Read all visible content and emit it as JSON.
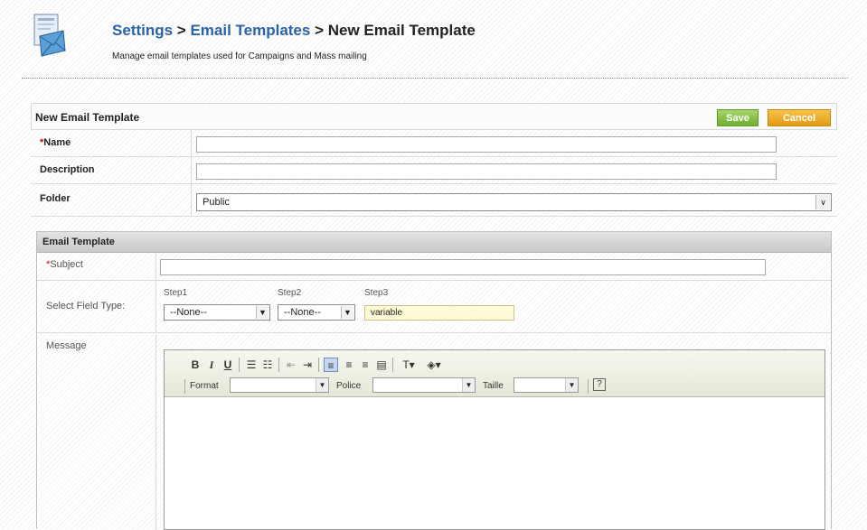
{
  "header": {
    "crumb_settings": "Settings",
    "sep1": " > ",
    "crumb_templates": "Email Templates",
    "sep2": " > ",
    "crumb_current": "New Email Template",
    "subtitle": "Manage email templates used for Campaigns and Mass mailing",
    "icon": "email-template-icon"
  },
  "form": {
    "title": "New Email Template",
    "save_label": "Save",
    "cancel_label": "Cancel",
    "name_req": "*",
    "name_label": "Name",
    "description_label": "Description",
    "folder_label": "Folder",
    "folder_value": "Public",
    "name_value": "",
    "description_value": ""
  },
  "template": {
    "title": "Email Template",
    "subject_req": "*",
    "subject_label": "Subject",
    "subject_value": "",
    "field_type_label": "Select Field Type:",
    "step1_label": "Step1",
    "step2_label": "Step2",
    "step3_label": "Step3",
    "step1_value": "--None--",
    "step2_value": "--None--",
    "step3_value": "variable",
    "message_label": "Message"
  },
  "editor": {
    "bold": "B",
    "italic": "I",
    "underline": "U",
    "format_label": "Format",
    "font_label": "Police",
    "size_label": "Taille",
    "help": "?"
  },
  "colors": {
    "link": "#2a62a8",
    "save": "#6fae2f",
    "cancel": "#e39b12",
    "required": "#cc0000",
    "variable_bg": "#fffbd6"
  }
}
